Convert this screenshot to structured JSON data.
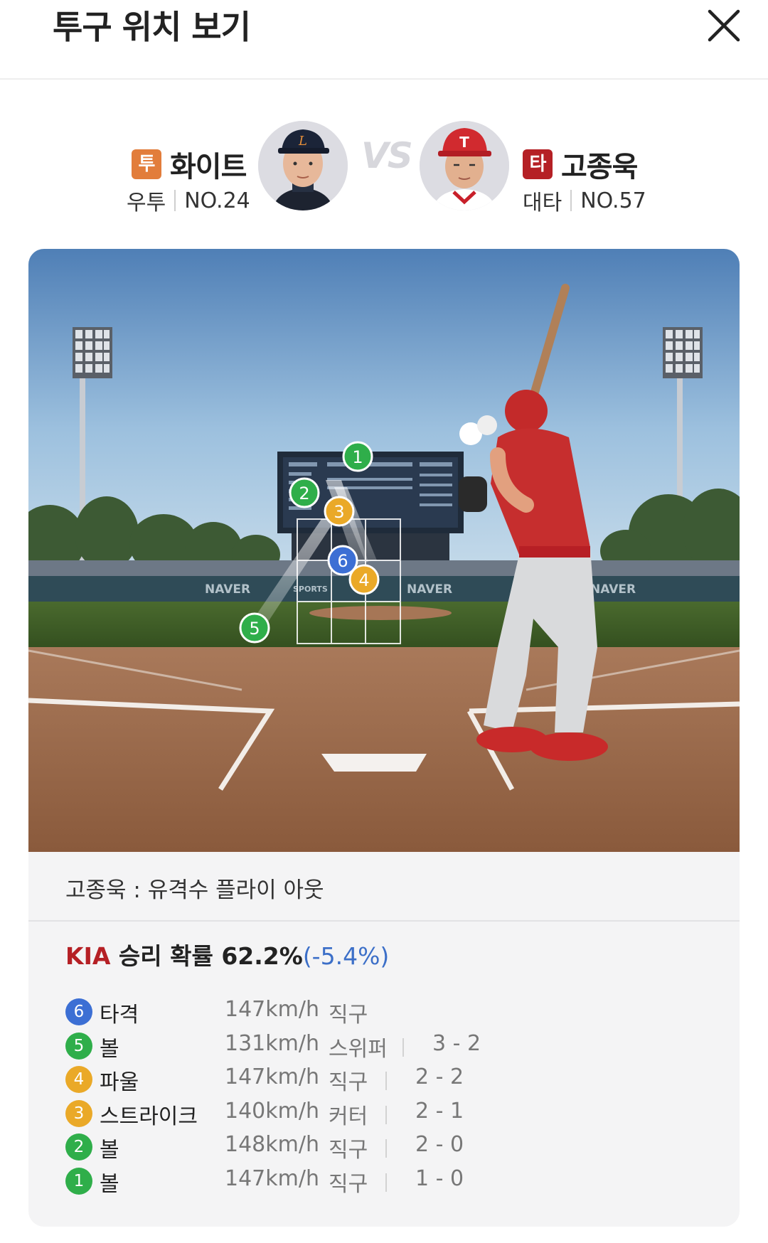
{
  "header": {
    "title": "투구 위치 보기"
  },
  "pitcher": {
    "role": "투",
    "role_color": "#e27d3b",
    "name": "화이트",
    "hand": "우투",
    "number": "NO.24"
  },
  "batter": {
    "role": "타",
    "role_color": "#b52025",
    "name": "고종욱",
    "hand": "대타",
    "number": "NO.57"
  },
  "vs_label": "VS",
  "scene": {
    "ad_text": "NAVER",
    "ad_text2": "SPORTS"
  },
  "result_text": "고종욱 : 유격수 플라이 아웃",
  "win_prob": {
    "team": "KIA",
    "label": " 승리 확률 ",
    "value": "62.2%",
    "delta": "(-5.4%)"
  },
  "colors": {
    "blue": "#3c6fd4",
    "green": "#2fae4a",
    "yellow": "#eaa928"
  },
  "pitches": [
    {
      "num": "6",
      "color": "#3c6fd4",
      "result": "타격",
      "speed": "147km/h",
      "type": "직구",
      "count": ""
    },
    {
      "num": "5",
      "color": "#2fae4a",
      "result": "볼",
      "speed": "131km/h",
      "type": "스위퍼",
      "count": "3 - 2"
    },
    {
      "num": "4",
      "color": "#eaa928",
      "result": "파울",
      "speed": "147km/h",
      "type": "직구",
      "count": "2 - 2"
    },
    {
      "num": "3",
      "color": "#eaa928",
      "result": "스트라이크",
      "speed": "140km/h",
      "type": "커터",
      "count": "2 - 1"
    },
    {
      "num": "2",
      "color": "#2fae4a",
      "result": "볼",
      "speed": "148km/h",
      "type": "직구",
      "count": "2 - 0"
    },
    {
      "num": "1",
      "color": "#2fae4a",
      "result": "볼",
      "speed": "147km/h",
      "type": "직구",
      "count": "1 - 0"
    }
  ]
}
